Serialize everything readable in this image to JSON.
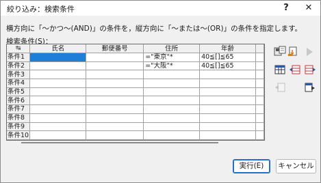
{
  "window": {
    "title": "絞り込み：検索条件",
    "help_label": "?",
    "close_label": "✕"
  },
  "description": "横方向に「～かつ～(AND)」の条件を，縦方向に「～または～(OR)」の条件を指定します。",
  "grid_label": "検索条件(S)：",
  "grid": {
    "corner_icon": "↹",
    "columns": [
      "氏名",
      "郵便番号",
      "住所",
      "年齢"
    ],
    "rows": [
      {
        "label": "条件1",
        "cells": [
          "",
          "",
          "=\"東京\"*",
          "40≦[]≦65"
        ]
      },
      {
        "label": "条件2",
        "cells": [
          "",
          "",
          "=\"大阪\"*",
          "40≦[]≦65"
        ]
      },
      {
        "label": "条件3",
        "cells": [
          "",
          "",
          "",
          ""
        ]
      },
      {
        "label": "条件4",
        "cells": [
          "",
          "",
          "",
          ""
        ]
      },
      {
        "label": "条件5",
        "cells": [
          "",
          "",
          "",
          ""
        ]
      },
      {
        "label": "条件6",
        "cells": [
          "",
          "",
          "",
          ""
        ]
      },
      {
        "label": "条件7",
        "cells": [
          "",
          "",
          "",
          ""
        ]
      },
      {
        "label": "条件8",
        "cells": [
          "",
          "",
          "",
          ""
        ]
      },
      {
        "label": "条件9",
        "cells": [
          "",
          "",
          "",
          ""
        ]
      },
      {
        "label": "条件10",
        "cells": [
          "",
          "",
          "",
          ""
        ]
      }
    ]
  },
  "toolbar": {
    "icons": [
      "save-condition-icon",
      "load-condition-icon",
      "play-icon",
      "table-icon",
      "insert-left-icon",
      "insert-right-icon",
      "move-left-icon",
      "move-right-icon"
    ]
  },
  "buttons": {
    "run_label": "実行(E)",
    "cancel_label": "キャンセル"
  },
  "colors": {
    "selection": "#1f7fd6",
    "accent_border": "#1f6fd0"
  }
}
